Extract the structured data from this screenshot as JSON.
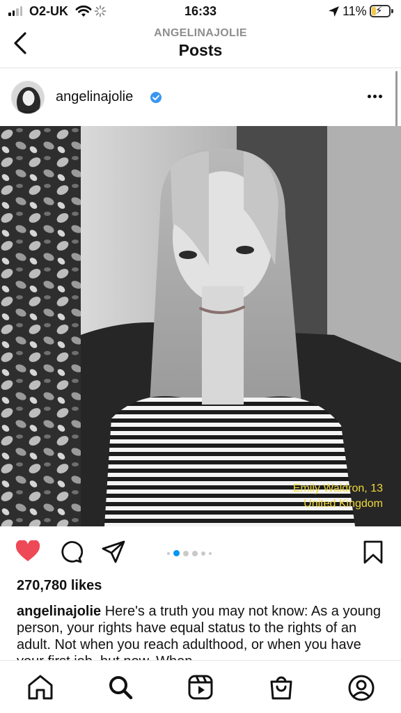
{
  "status_bar": {
    "carrier": "O2-UK",
    "time": "16:33",
    "battery_percent": "11%",
    "battery_level": 0.11,
    "icons": [
      "signal-icon",
      "wifi-icon",
      "activity-spinner-icon",
      "location-arrow-icon",
      "battery-charging-icon"
    ]
  },
  "header": {
    "username": "ANGELINAJOLIE",
    "title": "Posts",
    "back_icon": "chevron-left-icon"
  },
  "post": {
    "username": "angelinajolie",
    "verified_icon": "verified-badge-icon",
    "more_icon": "more-horizontal-icon",
    "photo_caption_name": "Emily Waldron, 13",
    "photo_caption_country": "United Kingdom",
    "caption_color": "#f0d93a",
    "likes": "270,780 likes",
    "caption_username": "angelinajolie",
    "caption_text": " Here's a truth you may not know: As a young person, your rights have equal status to the rights of an adult. Not when you reach adulthood, or when you have your first job, but now. When",
    "carousel_active_index": 1,
    "carousel_count": 6,
    "liked": true,
    "like_color": "#ed4956",
    "accent_color": "#0095f6"
  },
  "action_icons": [
    "heart-icon",
    "comment-icon",
    "share-icon",
    "bookmark-icon"
  ],
  "tab_bar": [
    "home-icon",
    "search-icon",
    "reels-icon",
    "shop-icon",
    "profile-icon"
  ]
}
